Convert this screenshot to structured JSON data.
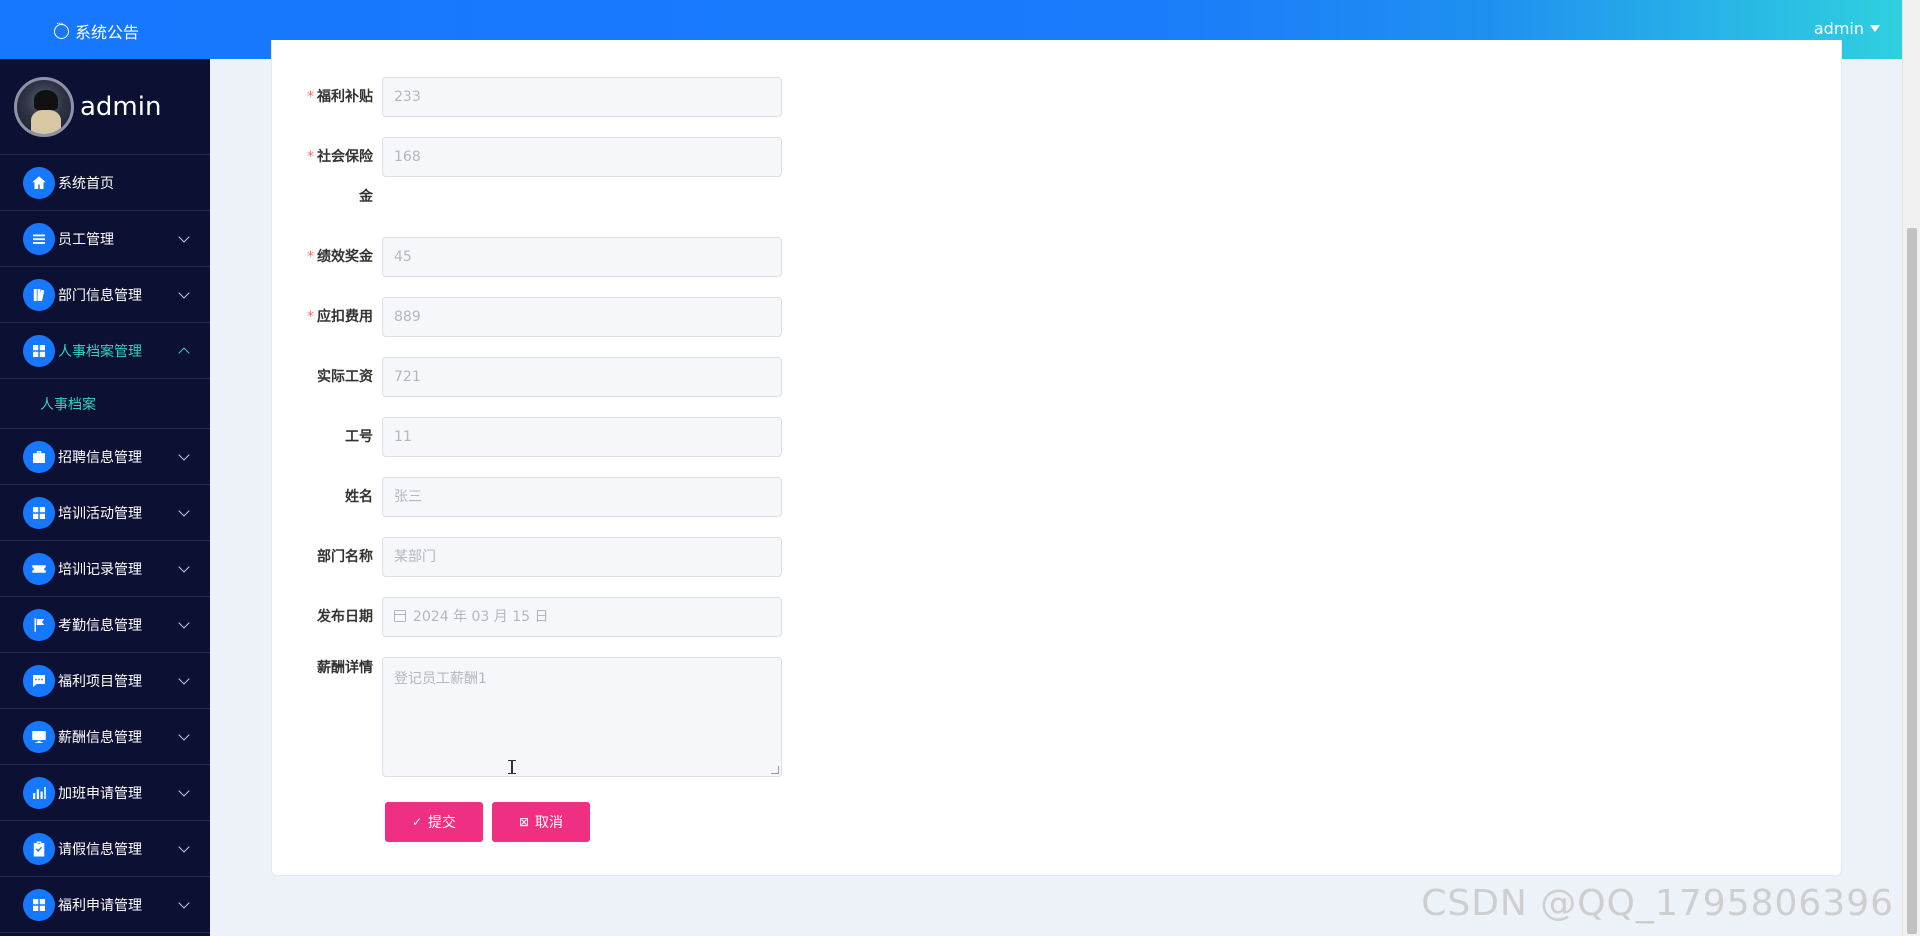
{
  "header": {
    "notice_label": "系统公告",
    "user_label": "admin"
  },
  "sidebar": {
    "profile_name": "admin",
    "items": [
      {
        "label": "系统首页"
      },
      {
        "label": "员工管理"
      },
      {
        "label": "部门信息管理"
      },
      {
        "label": "人事档案管理"
      },
      {
        "label": "人事档案"
      },
      {
        "label": "招聘信息管理"
      },
      {
        "label": "培训活动管理"
      },
      {
        "label": "培训记录管理"
      },
      {
        "label": "考勤信息管理"
      },
      {
        "label": "福利项目管理"
      },
      {
        "label": "薪酬信息管理"
      },
      {
        "label": "加班申请管理"
      },
      {
        "label": "请假信息管理"
      },
      {
        "label": "福利申请管理"
      }
    ]
  },
  "form": {
    "welfare_label": "福利补贴",
    "welfare_value": "233",
    "social_label_1": "社会保险",
    "social_label_2": "金",
    "social_value": "168",
    "bonus_label": "绩效奖金",
    "bonus_value": "45",
    "deduct_label": "应扣费用",
    "deduct_value": "889",
    "actual_label": "实际工资",
    "actual_value": "721",
    "empno_label": "工号",
    "empno_value": "11",
    "name_label": "姓名",
    "name_value": "张三",
    "dept_label": "部门名称",
    "dept_value": "某部门",
    "date_label": "发布日期",
    "date_value": "2024 年 03 月 15 日",
    "detail_label": "薪酬详情",
    "detail_value": "登记员工薪酬1",
    "required_mark": "*",
    "submit_label": "提交",
    "cancel_label": "取消"
  },
  "watermark": "CSDN @QQ_1795806396"
}
